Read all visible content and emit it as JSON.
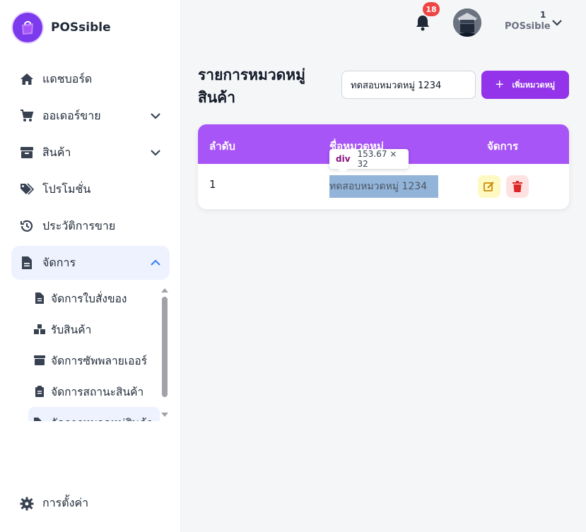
{
  "app": {
    "name": "POSsible"
  },
  "sidebar": {
    "items": [
      {
        "label": "แดชบอร์ด",
        "icon": "home-icon"
      },
      {
        "label": "ออเดอร์ขาย",
        "icon": "cart-icon",
        "expandable": true
      },
      {
        "label": "สินค้า",
        "icon": "box-icon",
        "expandable": true
      },
      {
        "label": "โปรโมชั่น",
        "icon": "tags-icon"
      },
      {
        "label": "ประวัติการขาย",
        "icon": "history-icon"
      },
      {
        "label": "จัดการ",
        "icon": "file-icon",
        "expanded": true
      }
    ],
    "subitems": [
      {
        "label": "จัดการใบสั่งของ",
        "icon": "file-icon"
      },
      {
        "label": "รับสินค้า",
        "icon": "boxes-icon"
      },
      {
        "label": "จัดการซัพพลายเออร์",
        "icon": "box-icon"
      },
      {
        "label": "จัดการสถานะสินค้า",
        "icon": "clipboard-icon"
      },
      {
        "label": "จัดการหมวดหมู่สินค้า",
        "icon": "tags-icon"
      }
    ],
    "settings_label": "การตั้งค่า"
  },
  "header": {
    "notification_count": "18",
    "user_number": "1",
    "user_name": "POSsible"
  },
  "main": {
    "title": "รายการหมวดหมู่สินค้า",
    "category_input": {
      "value": "ทดสอบหมวดหมู่ 1234",
      "placeholder": ""
    },
    "add_button_label": "เพิ่มหมวดหมู่",
    "table": {
      "headers": [
        "ลำดับ",
        "ชื่อหมวดหมู่",
        "จัดการ"
      ],
      "rows": [
        {
          "index": "1",
          "name": "ทดสอบหมวดหมู่ 1234"
        }
      ]
    }
  },
  "devtools_tooltip": {
    "tag": "div",
    "size": "153.67 × 32"
  },
  "colors": {
    "primary": "#9333ea",
    "table_header": "#a855f7",
    "badge": "#ef4444",
    "edit_bg": "#fef9c3",
    "delete_bg": "#fee2e2"
  }
}
